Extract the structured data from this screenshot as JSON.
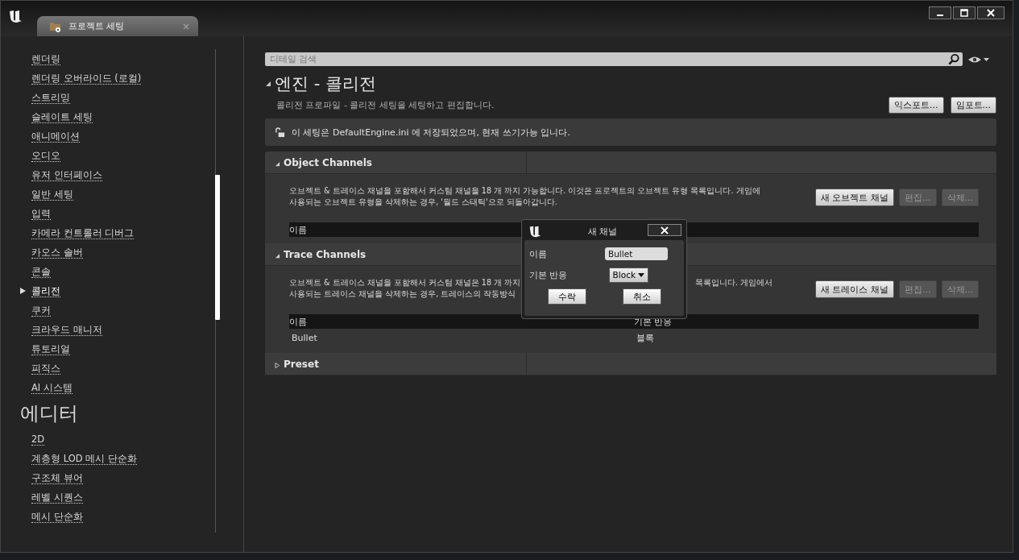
{
  "window": {
    "tab_title": "프로젝트 세팅",
    "tab_close": "×"
  },
  "sidebar": {
    "items": [
      {
        "label": "렌더링",
        "selected": false
      },
      {
        "label": "렌더링 오버라이드 (로컬)",
        "selected": false
      },
      {
        "label": "스트리밍",
        "selected": false
      },
      {
        "label": "슬레이트 세팅",
        "selected": false
      },
      {
        "label": "애니메이션",
        "selected": false
      },
      {
        "label": "오디오",
        "selected": false
      },
      {
        "label": "유저 인터페이스",
        "selected": false
      },
      {
        "label": "일반 세팅",
        "selected": false
      },
      {
        "label": "입력",
        "selected": false
      },
      {
        "label": "카메라 컨트롤러 디버그",
        "selected": false
      },
      {
        "label": "카오스 솔버",
        "selected": false
      },
      {
        "label": "콘솔",
        "selected": false
      },
      {
        "label": "콜리전",
        "selected": true
      },
      {
        "label": "쿠커",
        "selected": false
      },
      {
        "label": "크라우드 매니저",
        "selected": false
      },
      {
        "label": "튜토리얼",
        "selected": false
      },
      {
        "label": "피직스",
        "selected": false
      },
      {
        "label": "AI 시스템",
        "selected": false
      }
    ],
    "category": "에디터",
    "category_items": [
      {
        "label": "2D",
        "selected": false
      },
      {
        "label": "계층형 LOD 메시 단순화",
        "selected": false
      },
      {
        "label": "구조체 뷰어",
        "selected": false
      },
      {
        "label": "레벨 시퀀스",
        "selected": false
      },
      {
        "label": "메시 단순화",
        "selected": false
      }
    ]
  },
  "search": {
    "placeholder": "디테일 검색"
  },
  "section": {
    "title": "엔진 - 콜리전",
    "expanded": true,
    "description": "콜리전 프로파일 - 콜리전 세팅을 세팅하고 편집합니다.",
    "buttons": [
      "익스포트...",
      "임포트..."
    ]
  },
  "notice": "이 세팅은 DefaultEngine.ini 에 저장되었으며, 현재 쓰기가능 입니다.",
  "groups": [
    {
      "title": "Object Channels",
      "expanded": true,
      "description_lines": [
        [
          "오브젝트 & 트레이스 채널을 포함해서 커스텀 채널을 18 개 까지 가능합니다. 이것은 프로젝트의 오브젝트 유형 목록입니다. 게임에"
        ],
        [
          "사용되는 오브젝트 유형을 삭제하는 경우, '월드 스태틱'으로 되돌아갑니다."
        ]
      ],
      "buttons": [
        {
          "label": "새 오브젝트 채널",
          "disabled": false
        },
        {
          "label": "편집...",
          "disabled": true
        },
        {
          "label": "삭제...",
          "disabled": true
        }
      ],
      "columns": [
        "이름"
      ]
    },
    {
      "title": "Trace Channels",
      "expanded": true,
      "description_lines": [
        [
          "오브젝트 & 트레이스 채널을 포함해서 커스텀 채널은 18 개 까지",
          "목록입니다. 게임에서"
        ],
        [
          "사용되는 트레이스 채널을 삭제하는 경우, 트레이스의 작동방식"
        ]
      ],
      "buttons": [
        {
          "label": "새 트레이스 채널",
          "disabled": false
        },
        {
          "label": "편집...",
          "disabled": true
        },
        {
          "label": "삭제...",
          "disabled": true
        }
      ],
      "columns": [
        "이름",
        "기본 반응"
      ],
      "rows": [
        [
          "Bullet",
          "블록"
        ]
      ]
    },
    {
      "title": "Preset",
      "expanded": false
    }
  ],
  "dialog": {
    "title": "새 채널",
    "name_label": "이름",
    "name_value": "Bullet",
    "response_label": "기본 반응",
    "response_value": "Block",
    "buttons": [
      "수락",
      "취소"
    ]
  }
}
